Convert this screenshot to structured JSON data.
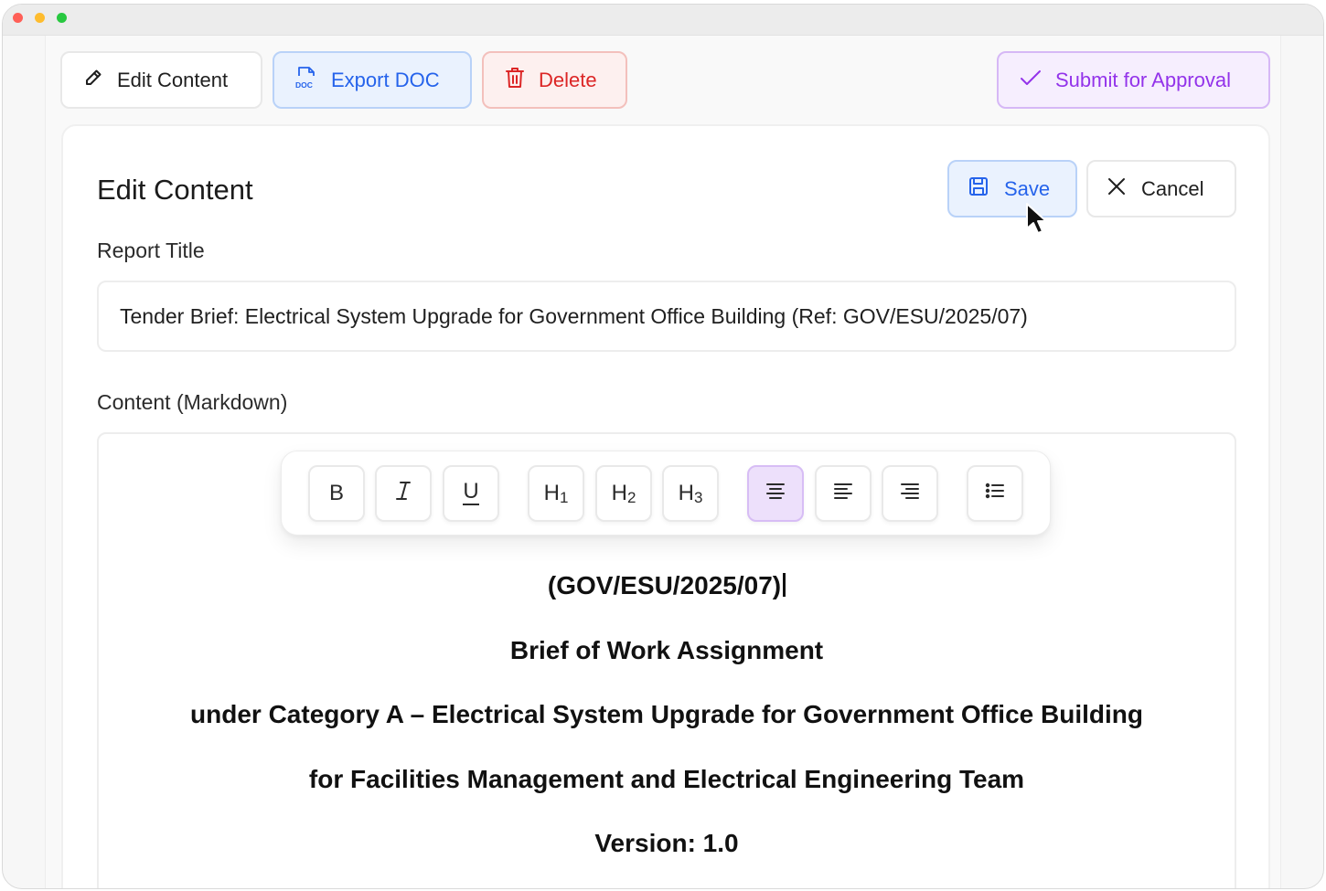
{
  "toolbar_top": {
    "edit_content": "Edit Content",
    "export_doc": "Export DOC",
    "delete": "Delete",
    "submit_for_approval": "Submit for Approval"
  },
  "card": {
    "title": "Edit Content",
    "save": "Save",
    "cancel": "Cancel"
  },
  "form": {
    "report_title_label": "Report Title",
    "report_title_value": "Tender Brief: Electrical System Upgrade for Government Office Building (Ref: GOV/ESU/2025/07)",
    "content_label": "Content (Markdown)"
  },
  "format_toolbar": {
    "bold": "B",
    "italic": "I",
    "underline": "U",
    "h1_letter": "H",
    "h1_num": "1",
    "h2_letter": "H",
    "h2_num": "2",
    "h3_letter": "H",
    "h3_num": "3",
    "active_tool": "align-center"
  },
  "document": {
    "lines": [
      "(GOV/ESU/2025/07)",
      "Brief of Work Assignment",
      "under Category A – Electrical System Upgrade for Government Office Building",
      "for Facilities Management and Electrical Engineering Team",
      "Version: 1.0"
    ]
  },
  "colors": {
    "accent_blue": "#2563eb",
    "danger_red": "#dc2626",
    "approve_purple": "#9333ea",
    "active_tool_bg": "#ede0fb"
  }
}
